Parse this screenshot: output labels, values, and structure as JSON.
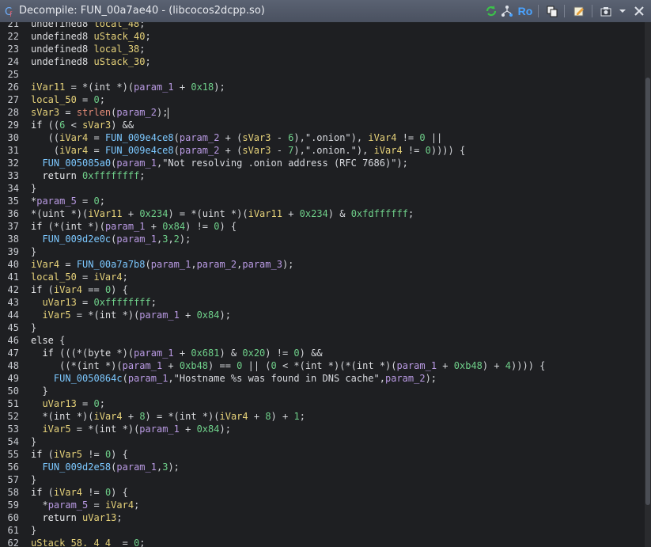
{
  "window": {
    "title": "Decompile: FUN_00a7ae40 -  (libcocos2dcpp.so)",
    "ro_label": "Ro"
  },
  "toolbar_icons": [
    "refresh-icon",
    "tree-icon",
    "read-only-icon",
    "copy-icon",
    "snapshot-icon",
    "edit-icon",
    "export-icon",
    "menu-chevron-icon",
    "close-icon"
  ],
  "lines": [
    {
      "n": "21",
      "parts": [
        [
          "t-type",
          "undefined8 "
        ],
        [
          "t-var",
          "local_48"
        ],
        [
          "t-op",
          ";"
        ]
      ]
    },
    {
      "n": "22",
      "parts": [
        [
          "t-type",
          "undefined8 "
        ],
        [
          "t-var",
          "uStack_40"
        ],
        [
          "t-op",
          ";"
        ]
      ]
    },
    {
      "n": "23",
      "parts": [
        [
          "t-type",
          "undefined8 "
        ],
        [
          "t-var",
          "local_38"
        ],
        [
          "t-op",
          ";"
        ]
      ]
    },
    {
      "n": "24",
      "parts": [
        [
          "t-type",
          "undefined8 "
        ],
        [
          "t-var",
          "uStack_30"
        ],
        [
          "t-op",
          ";"
        ]
      ]
    },
    {
      "n": "25",
      "parts": []
    },
    {
      "n": "26",
      "parts": [
        [
          "t-var",
          "iVar11"
        ],
        [
          "t-op",
          " = *("
        ],
        [
          "t-type",
          "int"
        ],
        [
          "t-op",
          " *)("
        ],
        [
          "t-param",
          "param_1"
        ],
        [
          "t-op",
          " + "
        ],
        [
          "t-num",
          "0x18"
        ],
        [
          "t-op",
          ");"
        ]
      ]
    },
    {
      "n": "27",
      "parts": [
        [
          "t-var",
          "local_50"
        ],
        [
          "t-op",
          " = "
        ],
        [
          "t-num",
          "0"
        ],
        [
          "t-op",
          ";"
        ]
      ]
    },
    {
      "n": "28",
      "parts": [
        [
          "t-var",
          "sVar3"
        ],
        [
          "t-op",
          " = "
        ],
        [
          "t-strlen",
          "strlen"
        ],
        [
          "t-op",
          "("
        ],
        [
          "t-param",
          "param_2"
        ],
        [
          "t-op",
          ");"
        ]
      ]
    },
    {
      "n": "29",
      "parts": [
        [
          "t-kw",
          "if"
        ],
        [
          "t-op",
          " (("
        ],
        [
          "t-num",
          "6"
        ],
        [
          "t-op",
          " < "
        ],
        [
          "t-var",
          "sVar3"
        ],
        [
          "t-op",
          ") &&"
        ]
      ]
    },
    {
      "n": "30",
      "parts": [
        [
          "t-op",
          "   (("
        ],
        [
          "t-var",
          "iVar4"
        ],
        [
          "t-op",
          " = "
        ],
        [
          "t-func",
          "FUN_009e4ce8"
        ],
        [
          "t-op",
          "("
        ],
        [
          "t-param",
          "param_2"
        ],
        [
          "t-op",
          " + ("
        ],
        [
          "t-var",
          "sVar3"
        ],
        [
          "t-op",
          " - "
        ],
        [
          "t-num",
          "6"
        ],
        [
          "t-op",
          "),"
        ],
        [
          "t-str",
          "\".onion\""
        ],
        [
          "t-op",
          "), "
        ],
        [
          "t-var",
          "iVar4"
        ],
        [
          "t-op",
          " != "
        ],
        [
          "t-num",
          "0"
        ],
        [
          "t-op",
          " ||"
        ]
      ]
    },
    {
      "n": "31",
      "parts": [
        [
          "t-op",
          "    ("
        ],
        [
          "t-var",
          "iVar4"
        ],
        [
          "t-op",
          " = "
        ],
        [
          "t-func",
          "FUN_009e4ce8"
        ],
        [
          "t-op",
          "("
        ],
        [
          "t-param",
          "param_2"
        ],
        [
          "t-op",
          " + ("
        ],
        [
          "t-var",
          "sVar3"
        ],
        [
          "t-op",
          " - "
        ],
        [
          "t-num",
          "7"
        ],
        [
          "t-op",
          "),"
        ],
        [
          "t-str",
          "\".onion.\""
        ],
        [
          "t-op",
          "), "
        ],
        [
          "t-var",
          "iVar4"
        ],
        [
          "t-op",
          " != "
        ],
        [
          "t-num",
          "0"
        ],
        [
          "t-op",
          ")))) {"
        ]
      ]
    },
    {
      "n": "32",
      "parts": [
        [
          "t-op",
          "  "
        ],
        [
          "t-func",
          "FUN_005085a0"
        ],
        [
          "t-op",
          "("
        ],
        [
          "t-param",
          "param_1"
        ],
        [
          "t-op",
          ","
        ],
        [
          "t-str",
          "\"Not resolving .onion address (RFC 7686)\""
        ],
        [
          "t-op",
          ");"
        ]
      ]
    },
    {
      "n": "33",
      "parts": [
        [
          "t-op",
          "  "
        ],
        [
          "t-kw",
          "return"
        ],
        [
          "t-op",
          " "
        ],
        [
          "t-num",
          "0xffffffff"
        ],
        [
          "t-op",
          ";"
        ]
      ]
    },
    {
      "n": "34",
      "parts": [
        [
          "t-op",
          "}"
        ]
      ]
    },
    {
      "n": "35",
      "parts": [
        [
          "t-op",
          "*"
        ],
        [
          "t-param",
          "param_5"
        ],
        [
          "t-op",
          " = "
        ],
        [
          "t-num",
          "0"
        ],
        [
          "t-op",
          ";"
        ]
      ]
    },
    {
      "n": "36",
      "parts": [
        [
          "t-op",
          "*("
        ],
        [
          "t-type",
          "uint"
        ],
        [
          "t-op",
          " *)("
        ],
        [
          "t-var",
          "iVar11"
        ],
        [
          "t-op",
          " + "
        ],
        [
          "t-num",
          "0x234"
        ],
        [
          "t-op",
          ") = *("
        ],
        [
          "t-type",
          "uint"
        ],
        [
          "t-op",
          " *)("
        ],
        [
          "t-var",
          "iVar11"
        ],
        [
          "t-op",
          " + "
        ],
        [
          "t-num",
          "0x234"
        ],
        [
          "t-op",
          ") & "
        ],
        [
          "t-num",
          "0xfdffffff"
        ],
        [
          "t-op",
          ";"
        ]
      ]
    },
    {
      "n": "37",
      "parts": [
        [
          "t-kw",
          "if"
        ],
        [
          "t-op",
          " (*("
        ],
        [
          "t-type",
          "int"
        ],
        [
          "t-op",
          " *)("
        ],
        [
          "t-param",
          "param_1"
        ],
        [
          "t-op",
          " + "
        ],
        [
          "t-num",
          "0x84"
        ],
        [
          "t-op",
          ") != "
        ],
        [
          "t-num",
          "0"
        ],
        [
          "t-op",
          ") {"
        ]
      ]
    },
    {
      "n": "38",
      "parts": [
        [
          "t-op",
          "  "
        ],
        [
          "t-func",
          "FUN_009d2e0c"
        ],
        [
          "t-op",
          "("
        ],
        [
          "t-param",
          "param_1"
        ],
        [
          "t-op",
          ","
        ],
        [
          "t-num",
          "3"
        ],
        [
          "t-op",
          ","
        ],
        [
          "t-num",
          "2"
        ],
        [
          "t-op",
          ");"
        ]
      ]
    },
    {
      "n": "39",
      "parts": [
        [
          "t-op",
          "}"
        ]
      ]
    },
    {
      "n": "40",
      "parts": [
        [
          "t-var",
          "iVar4"
        ],
        [
          "t-op",
          " = "
        ],
        [
          "t-func",
          "FUN_00a7a7b8"
        ],
        [
          "t-op",
          "("
        ],
        [
          "t-param",
          "param_1"
        ],
        [
          "t-op",
          ","
        ],
        [
          "t-param",
          "param_2"
        ],
        [
          "t-op",
          ","
        ],
        [
          "t-param",
          "param_3"
        ],
        [
          "t-op",
          ");"
        ]
      ]
    },
    {
      "n": "41",
      "parts": [
        [
          "t-var",
          "local_50"
        ],
        [
          "t-op",
          " = "
        ],
        [
          "t-var",
          "iVar4"
        ],
        [
          "t-op",
          ";"
        ]
      ]
    },
    {
      "n": "42",
      "parts": [
        [
          "t-kw",
          "if"
        ],
        [
          "t-op",
          " ("
        ],
        [
          "t-var",
          "iVar4"
        ],
        [
          "t-op",
          " == "
        ],
        [
          "t-num",
          "0"
        ],
        [
          "t-op",
          ") {"
        ]
      ]
    },
    {
      "n": "43",
      "parts": [
        [
          "t-op",
          "  "
        ],
        [
          "t-var",
          "uVar13"
        ],
        [
          "t-op",
          " = "
        ],
        [
          "t-num",
          "0xffffffff"
        ],
        [
          "t-op",
          ";"
        ]
      ]
    },
    {
      "n": "44",
      "parts": [
        [
          "t-op",
          "  "
        ],
        [
          "t-var",
          "iVar5"
        ],
        [
          "t-op",
          " = *("
        ],
        [
          "t-type",
          "int"
        ],
        [
          "t-op",
          " *)("
        ],
        [
          "t-param",
          "param_1"
        ],
        [
          "t-op",
          " + "
        ],
        [
          "t-num",
          "0x84"
        ],
        [
          "t-op",
          ");"
        ]
      ]
    },
    {
      "n": "45",
      "parts": [
        [
          "t-op",
          "}"
        ]
      ]
    },
    {
      "n": "46",
      "parts": [
        [
          "t-kw",
          "else"
        ],
        [
          "t-op",
          " {"
        ]
      ]
    },
    {
      "n": "47",
      "parts": [
        [
          "t-op",
          "  "
        ],
        [
          "t-kw",
          "if"
        ],
        [
          "t-op",
          " (((*("
        ],
        [
          "t-type",
          "byte"
        ],
        [
          "t-op",
          " *)("
        ],
        [
          "t-param",
          "param_1"
        ],
        [
          "t-op",
          " + "
        ],
        [
          "t-num",
          "0x681"
        ],
        [
          "t-op",
          ") & "
        ],
        [
          "t-num",
          "0x20"
        ],
        [
          "t-op",
          ") != "
        ],
        [
          "t-num",
          "0"
        ],
        [
          "t-op",
          ") &&"
        ]
      ]
    },
    {
      "n": "48",
      "parts": [
        [
          "t-op",
          "     ((*("
        ],
        [
          "t-type",
          "int"
        ],
        [
          "t-op",
          " *)("
        ],
        [
          "t-param",
          "param_1"
        ],
        [
          "t-op",
          " + "
        ],
        [
          "t-num",
          "0xb48"
        ],
        [
          "t-op",
          ") == "
        ],
        [
          "t-num",
          "0"
        ],
        [
          "t-op",
          " || ("
        ],
        [
          "t-num",
          "0"
        ],
        [
          "t-op",
          " < *("
        ],
        [
          "t-type",
          "int"
        ],
        [
          "t-op",
          " *)(*("
        ],
        [
          "t-type",
          "int"
        ],
        [
          "t-op",
          " *)("
        ],
        [
          "t-param",
          "param_1"
        ],
        [
          "t-op",
          " + "
        ],
        [
          "t-num",
          "0xb48"
        ],
        [
          "t-op",
          ") + "
        ],
        [
          "t-num",
          "4"
        ],
        [
          "t-op",
          ")))) {"
        ]
      ]
    },
    {
      "n": "49",
      "parts": [
        [
          "t-op",
          "    "
        ],
        [
          "t-func",
          "FUN_0050864c"
        ],
        [
          "t-op",
          "("
        ],
        [
          "t-param",
          "param_1"
        ],
        [
          "t-op",
          ","
        ],
        [
          "t-str",
          "\"Hostname %s was found in DNS cache\""
        ],
        [
          "t-op",
          ","
        ],
        [
          "t-param",
          "param_2"
        ],
        [
          "t-op",
          ");"
        ]
      ]
    },
    {
      "n": "50",
      "parts": [
        [
          "t-op",
          "  }"
        ]
      ]
    },
    {
      "n": "51",
      "parts": [
        [
          "t-op",
          "  "
        ],
        [
          "t-var",
          "uVar13"
        ],
        [
          "t-op",
          " = "
        ],
        [
          "t-num",
          "0"
        ],
        [
          "t-op",
          ";"
        ]
      ]
    },
    {
      "n": "52",
      "parts": [
        [
          "t-op",
          "  *("
        ],
        [
          "t-type",
          "int"
        ],
        [
          "t-op",
          " *)("
        ],
        [
          "t-var",
          "iVar4"
        ],
        [
          "t-op",
          " + "
        ],
        [
          "t-num",
          "8"
        ],
        [
          "t-op",
          ") = *("
        ],
        [
          "t-type",
          "int"
        ],
        [
          "t-op",
          " *)("
        ],
        [
          "t-var",
          "iVar4"
        ],
        [
          "t-op",
          " + "
        ],
        [
          "t-num",
          "8"
        ],
        [
          "t-op",
          ") + "
        ],
        [
          "t-num",
          "1"
        ],
        [
          "t-op",
          ";"
        ]
      ]
    },
    {
      "n": "53",
      "parts": [
        [
          "t-op",
          "  "
        ],
        [
          "t-var",
          "iVar5"
        ],
        [
          "t-op",
          " = *("
        ],
        [
          "t-type",
          "int"
        ],
        [
          "t-op",
          " *)("
        ],
        [
          "t-param",
          "param_1"
        ],
        [
          "t-op",
          " + "
        ],
        [
          "t-num",
          "0x84"
        ],
        [
          "t-op",
          ");"
        ]
      ]
    },
    {
      "n": "54",
      "parts": [
        [
          "t-op",
          "}"
        ]
      ]
    },
    {
      "n": "55",
      "parts": [
        [
          "t-kw",
          "if"
        ],
        [
          "t-op",
          " ("
        ],
        [
          "t-var",
          "iVar5"
        ],
        [
          "t-op",
          " != "
        ],
        [
          "t-num",
          "0"
        ],
        [
          "t-op",
          ") {"
        ]
      ]
    },
    {
      "n": "56",
      "parts": [
        [
          "t-op",
          "  "
        ],
        [
          "t-func",
          "FUN_009d2e58"
        ],
        [
          "t-op",
          "("
        ],
        [
          "t-param",
          "param_1"
        ],
        [
          "t-op",
          ","
        ],
        [
          "t-num",
          "3"
        ],
        [
          "t-op",
          ");"
        ]
      ]
    },
    {
      "n": "57",
      "parts": [
        [
          "t-op",
          "}"
        ]
      ]
    },
    {
      "n": "58",
      "parts": [
        [
          "t-kw",
          "if"
        ],
        [
          "t-op",
          " ("
        ],
        [
          "t-var",
          "iVar4"
        ],
        [
          "t-op",
          " != "
        ],
        [
          "t-num",
          "0"
        ],
        [
          "t-op",
          ") {"
        ]
      ]
    },
    {
      "n": "59",
      "parts": [
        [
          "t-op",
          "  *"
        ],
        [
          "t-param",
          "param_5"
        ],
        [
          "t-op",
          " = "
        ],
        [
          "t-var",
          "iVar4"
        ],
        [
          "t-op",
          ";"
        ]
      ]
    },
    {
      "n": "60",
      "parts": [
        [
          "t-op",
          "  "
        ],
        [
          "t-kw",
          "return"
        ],
        [
          "t-op",
          " "
        ],
        [
          "t-var",
          "uVar13"
        ],
        [
          "t-op",
          ";"
        ]
      ]
    },
    {
      "n": "61",
      "parts": [
        [
          "t-op",
          "}"
        ]
      ]
    },
    {
      "n": "62",
      "parts": [
        [
          "t-var",
          "uStack_58._4_4_"
        ],
        [
          "t-op",
          " = "
        ],
        [
          "t-num",
          "0"
        ],
        [
          "t-op",
          ";"
        ]
      ]
    }
  ]
}
